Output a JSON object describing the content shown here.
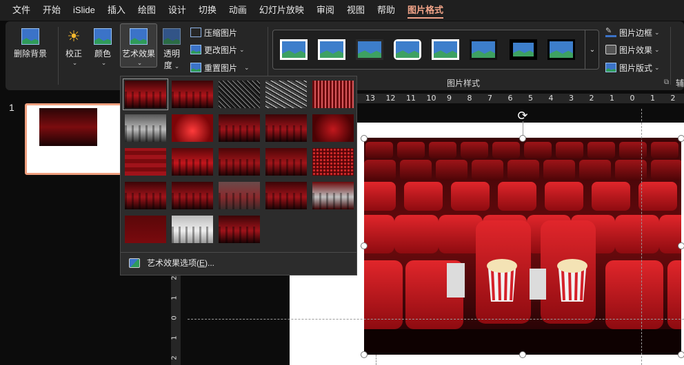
{
  "menu": {
    "items": [
      "文件",
      "开始",
      "iSlide",
      "插入",
      "绘图",
      "设计",
      "切换",
      "动画",
      "幻灯片放映",
      "审阅",
      "视图",
      "帮助"
    ],
    "active": "图片格式"
  },
  "ribbon": {
    "remove_bg": "删除背景",
    "corrections": "校正",
    "color": "颜色",
    "artistic_effects": "艺术效果",
    "transparency_line1": "透明",
    "transparency_line2": "度",
    "compress": "压缩图片",
    "change": "更改图片",
    "reset": "重置图片",
    "styles_group_label": "图片样式",
    "border": "图片边框",
    "effects": "图片效果",
    "layout": "图片版式",
    "aux": "辅"
  },
  "slides_pane": {
    "slide_number": "1"
  },
  "ruler": {
    "h_ticks": [
      "13",
      "12",
      "11",
      "10",
      "9",
      "8",
      "7",
      "6",
      "5",
      "4",
      "3",
      "2",
      "1",
      "0",
      "1",
      "2"
    ],
    "v_ticks": [
      "2",
      "1",
      "0",
      "1",
      "2"
    ]
  },
  "gallery": {
    "options_label": "艺术效果选项(",
    "options_key": "E",
    "options_suffix": ")..."
  },
  "colors": {
    "accent": "#f2a489",
    "ribbon_bg": "#262626",
    "menu_bg": "#1f1f1f"
  }
}
